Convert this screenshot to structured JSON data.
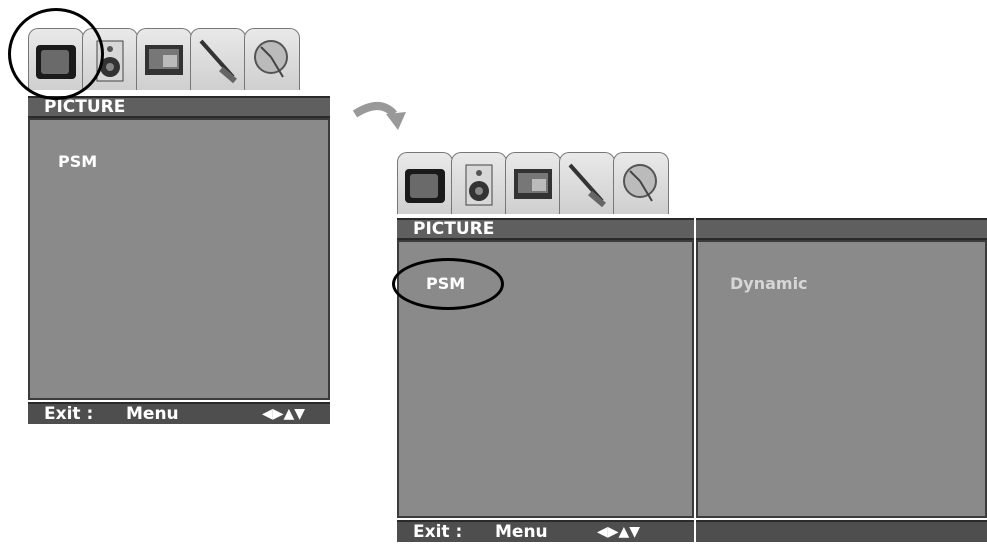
{
  "left_menu": {
    "title": "PICTURE",
    "item": "PSM",
    "footer_exit": "Exit :",
    "footer_menu": "Menu",
    "footer_arrows": "◀▶▲▼",
    "tabs": [
      "tv-icon",
      "speaker-icon",
      "screen-icon",
      "antenna-icon",
      "dish-icon"
    ]
  },
  "right_menu": {
    "title": "PICTURE",
    "item": "PSM",
    "value": "Dynamic",
    "footer_exit": "Exit :",
    "footer_menu": "Menu",
    "footer_arrows": "◀▶▲▼",
    "tabs": [
      "tv-icon",
      "speaker-icon",
      "screen-icon",
      "antenna-icon",
      "dish-icon"
    ]
  },
  "arrow": "curved-arrow-icon",
  "colors": {
    "panel": "#8a8a8a",
    "titlebar": "#5f5f5f",
    "footer": "#4e4e4e",
    "text": "#ffffff"
  }
}
